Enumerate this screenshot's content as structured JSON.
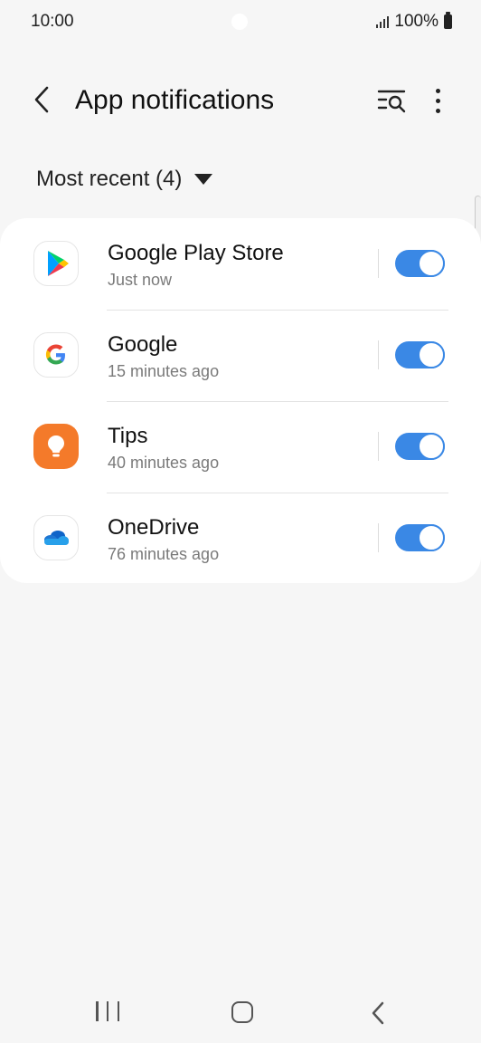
{
  "status_bar": {
    "time": "10:00",
    "battery": "100%"
  },
  "app_bar": {
    "title": "App notifications"
  },
  "filter": {
    "label": "Most recent (4)"
  },
  "apps": [
    {
      "name": "Google Play Store",
      "time": "Just now",
      "enabled": true,
      "icon": "google-play-store-icon"
    },
    {
      "name": "Google",
      "time": "15 minutes ago",
      "enabled": true,
      "icon": "google-icon"
    },
    {
      "name": "Tips",
      "time": "40 minutes ago",
      "enabled": true,
      "icon": "tips-icon"
    },
    {
      "name": "OneDrive",
      "time": "76 minutes ago",
      "enabled": true,
      "icon": "onedrive-icon"
    }
  ],
  "colors": {
    "toggle_on": "#3a88e5",
    "tips_orange": "#f47a2a",
    "onedrive_blue": "#1e76d3"
  }
}
